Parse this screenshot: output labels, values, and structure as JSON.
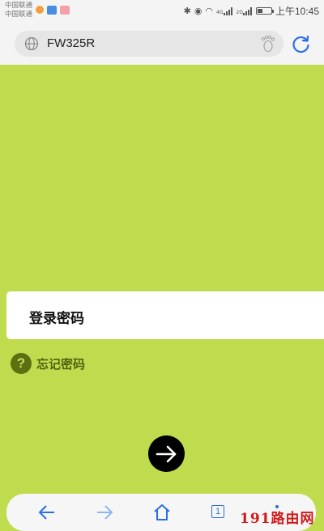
{
  "status_bar": {
    "carrier_1": "中国联通",
    "carrier_2": "中国联通",
    "signal_1_label": "4G",
    "signal_2_label": "2G",
    "time": "上午10:45"
  },
  "address_bar": {
    "url": "FW325R"
  },
  "login": {
    "password_label": "登录密码",
    "forgot_password": "忘记密码",
    "forgot_icon_glyph": "?"
  },
  "toolbar": {
    "tab_count": "1"
  },
  "watermark": "191路由网",
  "colors": {
    "page_background": "#bfdc4e",
    "accent_blue": "#2a6ee5",
    "forgot_green": "#4f6410",
    "watermark_red": "#d11a1a"
  },
  "icons": [
    "globe-icon",
    "footprint-icon",
    "refresh-icon",
    "help-icon",
    "arrow-right-icon",
    "back-icon",
    "forward-icon",
    "home-icon",
    "tabs-icon",
    "menu-icon"
  ]
}
